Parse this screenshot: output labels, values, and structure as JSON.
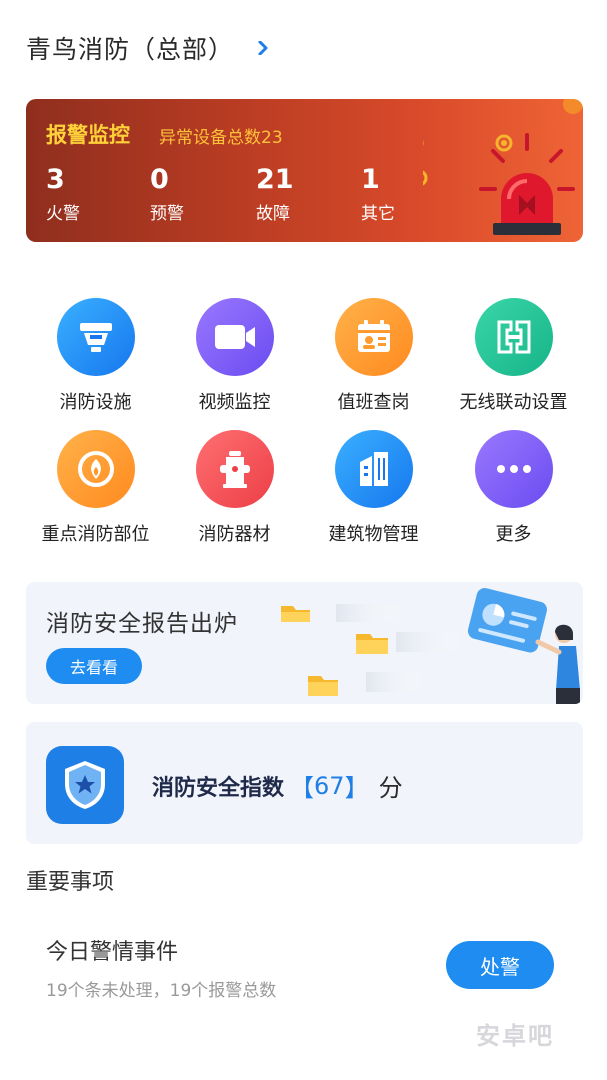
{
  "header": {
    "title": "青鸟消防（总部）"
  },
  "alarm": {
    "title": "报警监控",
    "subtitle": "异常设备总数23",
    "stats": [
      {
        "value": "3",
        "label": "火警"
      },
      {
        "value": "0",
        "label": "预警"
      },
      {
        "value": "21",
        "label": "故障"
      },
      {
        "value": "1",
        "label": "其它"
      }
    ]
  },
  "grid": {
    "items": [
      {
        "label": "消防设施",
        "icon": "smoke-detector-icon",
        "color": "#1e90ff"
      },
      {
        "label": "视频监控",
        "icon": "video-camera-icon",
        "color": "#7b5cf5"
      },
      {
        "label": "值班查岗",
        "icon": "duty-calendar-icon",
        "color": "#ff9a2e"
      },
      {
        "label": "无线联动设置",
        "icon": "wireless-link-icon",
        "color": "#22c49a"
      },
      {
        "label": "重点消防部位",
        "icon": "fire-target-icon",
        "color": "#ff9a2e"
      },
      {
        "label": "消防器材",
        "icon": "fire-hydrant-icon",
        "color": "#f2555a"
      },
      {
        "label": "建筑物管理",
        "icon": "building-icon",
        "color": "#1e90ff"
      },
      {
        "label": "更多",
        "icon": "more-icon",
        "color": "#7b5cf5"
      }
    ]
  },
  "report": {
    "title": "消防安全报告出炉",
    "button": "去看看"
  },
  "safety_index": {
    "label": "消防安全指数",
    "bracket_open": "【",
    "value": "67",
    "bracket_close": "】",
    "unit": "分"
  },
  "important": {
    "section_title": "重要事项",
    "event_title": "今日警情事件",
    "event_sub": "19个条未处理，19个报警总数",
    "button": "处警"
  },
  "watermark": "安卓吧"
}
